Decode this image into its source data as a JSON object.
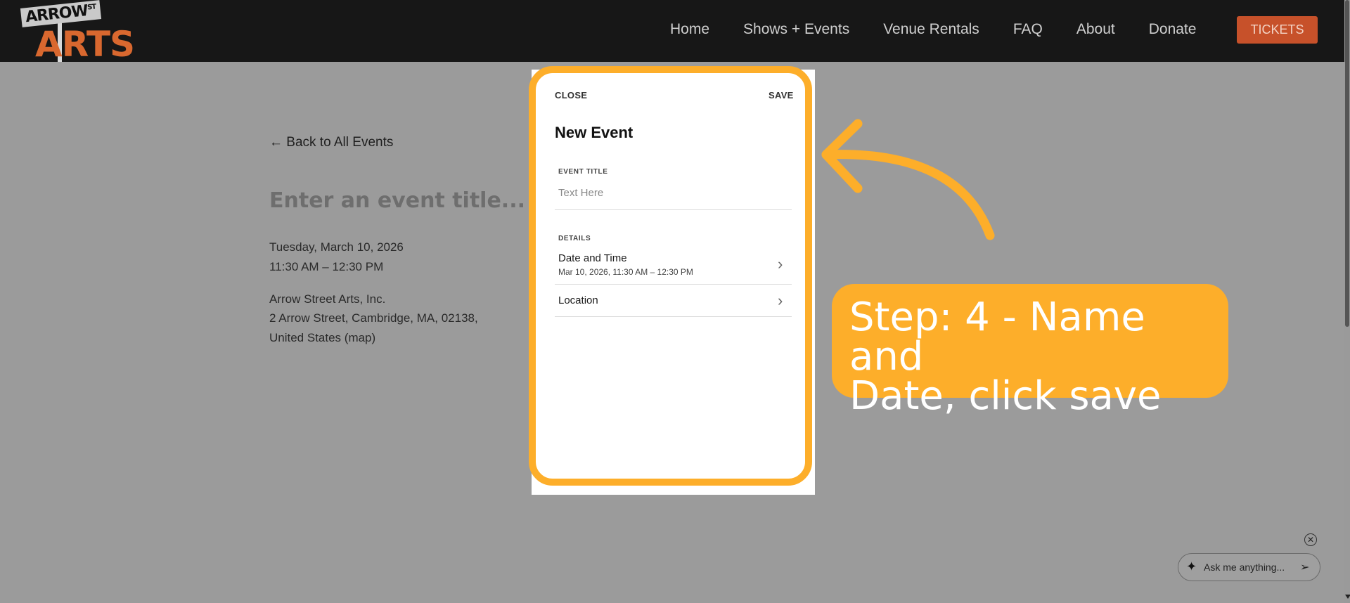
{
  "header": {
    "logo": {
      "line1": "ARROW",
      "sup": "ST",
      "line2": "ARTS"
    },
    "nav": [
      "Home",
      "Shows + Events",
      "Venue Rentals",
      "FAQ",
      "About",
      "Donate"
    ],
    "tickets_label": "TICKETS"
  },
  "page": {
    "back_link": "← Back to All Events",
    "event_title_placeholder": "Enter an event title...",
    "date": "Tuesday, March 10, 2026",
    "time": "11:30 AM – 12:30 PM",
    "venue": "Arrow Street Arts, Inc.",
    "address_line1": "2 Arrow Street, Cambridge, MA, 02138,",
    "address_line2": "United States (map)"
  },
  "modal": {
    "close_label": "CLOSE",
    "save_label": "SAVE",
    "title": "New Event",
    "event_title_label": "EVENT TITLE",
    "event_title_placeholder": "Text Here",
    "details_label": "DETAILS",
    "date_time_label": "Date and Time",
    "date_time_value": "Mar 10, 2026, 11:30 AM – 12:30 PM",
    "location_label": "Location"
  },
  "callout": {
    "text_line1": "Step: 4 - Name and",
    "text_line2": "Date, click save"
  },
  "chat": {
    "placeholder": "Ask me anything...",
    "close_symbol": "✕"
  },
  "colors": {
    "accent": "#fdae2a",
    "tickets": "#c7512a",
    "header_bg": "#171717"
  }
}
